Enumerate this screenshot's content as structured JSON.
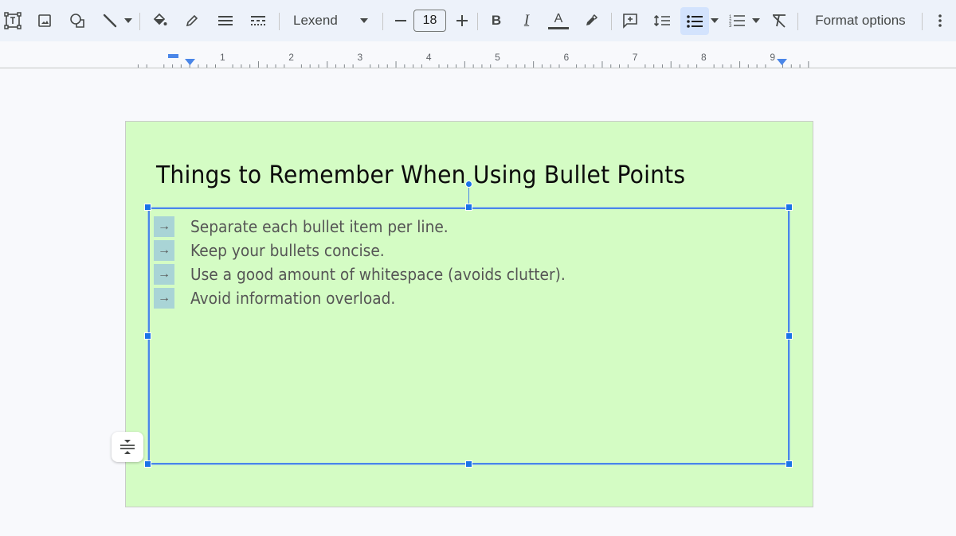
{
  "toolbar": {
    "items": [
      {
        "name": "text-box-icon"
      },
      {
        "name": "image-icon"
      },
      {
        "name": "shape-icon"
      },
      {
        "name": "line-icon"
      },
      {
        "name": "fill-color-icon"
      },
      {
        "name": "border-color-icon"
      },
      {
        "name": "border-weight-icon"
      },
      {
        "name": "border-dash-icon"
      }
    ],
    "font_name": "Lexend",
    "font_size": "18",
    "decrease_label": "−",
    "increase_label": "+",
    "bold_label": "B",
    "italic_label": "I",
    "text_color_label": "A",
    "format_options_label": "Format options",
    "bulleted_list_active": true,
    "accent_color": "#1a73e8"
  },
  "ruler": {
    "labels": [
      "1",
      "2",
      "3",
      "4",
      "5",
      "6",
      "7",
      "8",
      "9"
    ]
  },
  "slide": {
    "background_color": "#d4fcc4",
    "title": "Things to Remember When Using Bullet Points",
    "bullet_glyph": "→",
    "bullets": [
      "Separate each bullet item per line.",
      "Keep your bullets concise.",
      "Use a good amount of whitespace (avoids clutter).",
      "Avoid information overload."
    ]
  }
}
